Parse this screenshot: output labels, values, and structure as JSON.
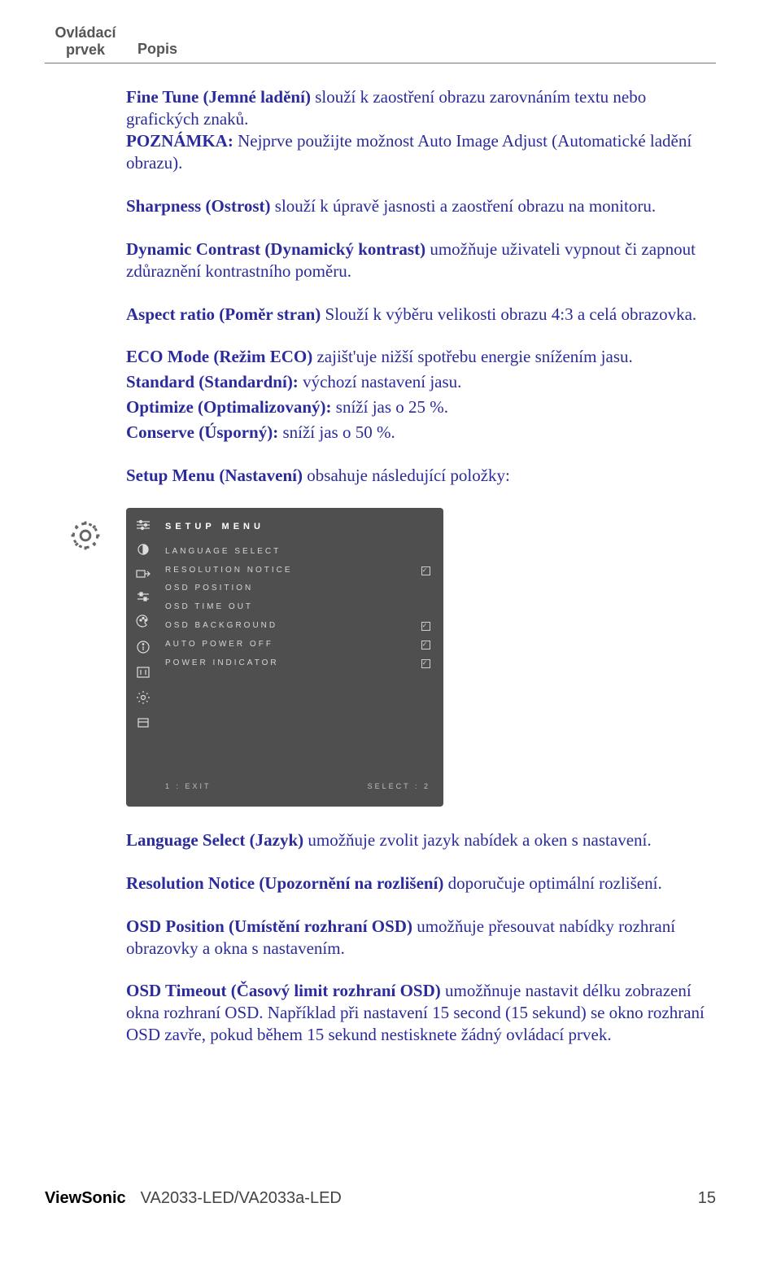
{
  "header": {
    "control": "Ovládací prvek",
    "desc": "Popis"
  },
  "p1_b": "Fine Tune (Jemné ladění)",
  "p1_t": " slouží k zaostření obrazu zarovnáním textu nebo grafických znaků.",
  "p1n_b": "POZNÁMKA:",
  "p1n_t": " Nejprve použijte možnost Auto Image Adjust (Automatické ladění obrazu).",
  "p2_b": "Sharpness (Ostrost)",
  "p2_t": " slouží k úpravě jasnosti a zaostření obrazu na monitoru.",
  "p3_b": "Dynamic Contrast (Dynamický kontrast)",
  "p3_t": " umožňuje uživateli vypnout či zapnout zdůraznění kontrastního poměru.",
  "p4_b": "Aspect ratio (Poměr stran)",
  "p4_t": " Slouží k výběru velikosti obrazu 4:3  a celá obrazovka.",
  "p5_b": "ECO Mode (Režim ECO)",
  "p5_t": " zajišt'uje nižší spotřebu energie snížením jasu.",
  "p5a_b": "Standard (Standardní):",
  "p5a_t": " výchozí nastavení jasu.",
  "p5b_b": "Optimize (Optimalizovaný):",
  "p5b_t": " sníží jas o 25 %.",
  "p5c_b": "Conserve (Úsporný):",
  "p5c_t": " sníží jas o 50 %.",
  "p6_b": "Setup Menu  (Nastavení)",
  "p6_t": " obsahuje následující položky:",
  "osd": {
    "title": "SETUP MENU",
    "items": [
      {
        "label": "LANGUAGE SELECT",
        "check": ""
      },
      {
        "label": "RESOLUTION NOTICE",
        "check": "✓"
      },
      {
        "label": "OSD POSITION",
        "check": ""
      },
      {
        "label": "OSD TIME OUT",
        "check": ""
      },
      {
        "label": "OSD BACKGROUND",
        "check": "✓"
      },
      {
        "label": "AUTO POWER OFF",
        "check": "✓"
      },
      {
        "label": "POWER INDICATOR",
        "check": "✓"
      }
    ],
    "footer_left": "1 : EXIT",
    "footer_right": "SELECT : 2"
  },
  "p7_b": "Language Select  (Jazyk)",
  "p7_t": " umožňuje zvolit jazyk nabídek a oken s nastavení.",
  "p8_b": "Resolution Notice (Upozornění na rozlišení)",
  "p8_t": " doporučuje optimální rozlišení.",
  "p9_b": "OSD Position (Umístění rozhraní OSD)",
  "p9_t": " umožňuje přesouvat nabídky rozhraní obrazovky a okna s nastavením.",
  "p10_b": "OSD Timeout (Časový limit rozhraní OSD)",
  "p10_t": " umožňnuje nastavit délku zobrazení okna rozhraní OSD. Například při nastavení 15 second (15 sekund) se okno rozhraní OSD zavře, pokud během 15 sekund nestisknete žádný ovládací prvek.",
  "footer": {
    "brand": "ViewSonic",
    "model": "VA2033-LED/VA2033a-LED",
    "page": "15"
  }
}
